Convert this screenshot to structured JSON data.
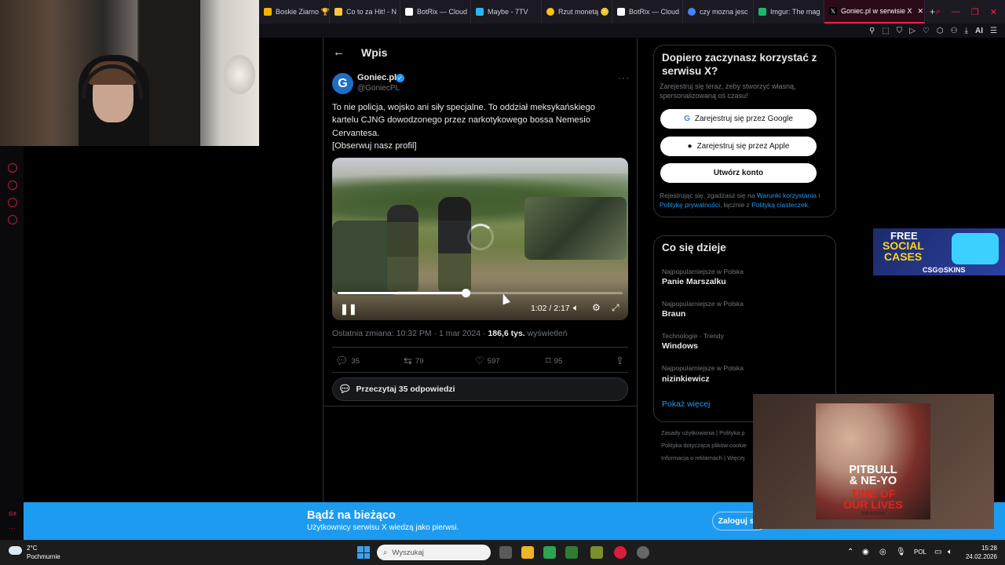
{
  "browser": {
    "tabs": [
      {
        "label": "Boskie Ziarno 🏆",
        "fav_color": "#f5b400",
        "icon": "tab-favicon"
      },
      {
        "label": "Co to za Hit! - N",
        "fav_color": "#f5c542",
        "icon": "tab-favicon"
      },
      {
        "label": "BotRix — Cloud",
        "fav_color": "#ffffff",
        "icon": "tab-favicon"
      },
      {
        "label": "Maybe - 7TV",
        "fav_color": "#29b6f6",
        "icon": "tab-favicon"
      },
      {
        "label": "Rzut monetą 🪙",
        "fav_color": "#f9c21a",
        "icon": "tab-favicon"
      },
      {
        "label": "BotRix — Cloud",
        "fav_color": "#ffffff",
        "icon": "tab-favicon"
      },
      {
        "label": "czy mozna jesc",
        "fav_color": "#4285f4",
        "icon": "tab-favicon"
      },
      {
        "label": "Imgur: The mag",
        "fav_color": "#1bb76e",
        "icon": "tab-favicon"
      },
      {
        "label": "Goniec.pl w serwisie X",
        "fav_color": "#000000",
        "icon": "tab-favicon"
      }
    ],
    "new_tab": "+",
    "accent": "#fa1e4e",
    "toolbar_ai": "AI"
  },
  "tweet": {
    "header_title": "Wpis",
    "back": "←",
    "author_name": "Goniec.pl",
    "author_handle": "@GoniecPL",
    "avatar_letter": "G",
    "verified": "✓",
    "more": "···",
    "text_lines": [
      "To nie policja, wojsko ani siły specjalne. To oddział meksykańskiego",
      "kartelu CJNG dowodzonego przez narkotykowego bossa Nemesio",
      "Cervantesa.",
      "[Obserwuj nasz profil]"
    ],
    "video": {
      "time": "1:02 / 2:17",
      "progress": 0.45,
      "play_icon": "pause-icon"
    },
    "meta_prefix": "Ostatnia zmiana: 10:32 PM · 1 mar 2024 · ",
    "meta_views": "186,6 tys.",
    "meta_suffix": " wyświetleń",
    "actions": {
      "replies": "35",
      "reposts": "79",
      "likes": "597",
      "bookmarks": "95"
    },
    "read_replies": "Przeczytaj 35 odpowiedzi"
  },
  "signup": {
    "title": "Dopiero zaczynasz korzystać z serwisu X?",
    "subtitle": "Zarejestruj się teraz, żeby stworzyć własną, spersonalizowaną oś czasu!",
    "google": "Zarejestruj się przez Google",
    "apple": "Zarejestruj się przez Apple",
    "create": "Utwórz konto",
    "legal_1": "Rejestrując się, zgadzasz się na ",
    "legal_terms": "Warunki korzystania",
    "legal_2": " i ",
    "legal_privacy": "Politykę prywatności",
    "legal_3": ", łącznie z ",
    "legal_cookies": "Polityką ciasteczek",
    "legal_4": "."
  },
  "trends": {
    "title": "Co się dzieje",
    "items": [
      {
        "category": "Najpopularniejsze w Polska",
        "name": "Panie Marszalku"
      },
      {
        "category": "Najpopularniejsze w Polska",
        "name": "Braun"
      },
      {
        "category": "Technologie · Trendy",
        "name": "Windows"
      },
      {
        "category": "Najpopularniejsze w Polska",
        "name": "nizinkiewicz"
      }
    ],
    "show_more": "Pokaż więcej"
  },
  "footer": {
    "line1": "Zasady użytkowania  |  Polityka p",
    "line2": "Polityka dotycząca plików cookie",
    "line3": "Informacja o reklamach  |  Więcej"
  },
  "ad": {
    "free": "FREE",
    "social": "SOCIAL",
    "cases": "CASES",
    "brand": "CSG⊙SKINS"
  },
  "bottom_bar": {
    "title": "Bądź na bieżąco",
    "subtitle": "Użytkownicy serwisu X wiedzą jako pierwsi.",
    "login": "Zaloguj się"
  },
  "album": {
    "artist_line1": "PITBULL",
    "artist_line2": "& NE-YO",
    "song_line1": "TIME OF",
    "song_line2": "OUR LIVES",
    "label": "TOPSOUND"
  },
  "taskbar": {
    "temp": "2°C",
    "weather": "Pochmurnie",
    "search": "Wyszukaj",
    "lang": "POL",
    "time": "15:28",
    "date": "24.02.2026"
  },
  "gx_sidebar": {
    "label": "GX"
  }
}
